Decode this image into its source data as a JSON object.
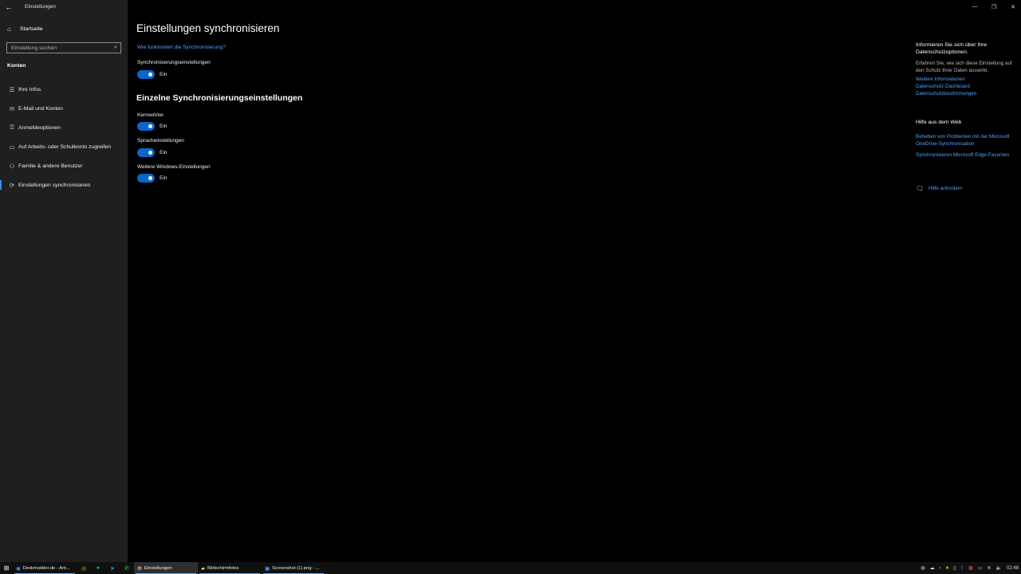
{
  "window": {
    "title": "Einstellungen",
    "minimize_glyph": "—",
    "restore_glyph": "❐",
    "close_glyph": "✕"
  },
  "sidebar": {
    "home_label": "Startseite",
    "search_placeholder": "Einstellung suchen",
    "section": "Konten",
    "items": [
      {
        "label": "Ihre Infos",
        "icon": "person-card-icon",
        "glyph": "☰"
      },
      {
        "label": "E-Mail und Konten",
        "icon": "mail-icon",
        "glyph": "✉"
      },
      {
        "label": "Anmeldeoptionen",
        "icon": "key-icon",
        "glyph": "⚿"
      },
      {
        "label": "Auf Arbeits- oder Schulkonto zugreifen",
        "icon": "briefcase-icon",
        "glyph": "▭"
      },
      {
        "label": "Familie & andere Benutzer",
        "icon": "user-add-icon",
        "glyph": "⚇"
      },
      {
        "label": "Einstellungen synchronisieren",
        "icon": "sync-icon",
        "glyph": "⟳"
      }
    ]
  },
  "main": {
    "title": "Einstellungen synchronisieren",
    "how_link": "Wie funktioniert die Synchronisierung?",
    "sync_label": "Synchronisierungseinstellungen",
    "sync_state": "Ein",
    "individual_heading": "Einzelne Synchronisierungseinstellungen",
    "toggles": [
      {
        "label": "Kennwörter",
        "state": "Ein"
      },
      {
        "label": "Spracheinstellungen",
        "state": "Ein"
      },
      {
        "label": "Weitere Windows-Einstellungen",
        "state": "Ein"
      }
    ]
  },
  "right_panel": {
    "privacy_heading": "Informieren Sie sich über Ihre Datenschutzoptionen.",
    "privacy_text": "Erfahren Sie, wie sich diese Einstellung auf den Schutz Ihrer Daten auswirkt.",
    "privacy_links": [
      "Weitere Informationen",
      "Datenschutz-Dashboard",
      "Datenschutzbestimmungen"
    ],
    "web_heading": "Hilfe aus dem Web",
    "web_links": [
      "Beheben von Problemen mit der Microsoft OneDrive-Synchronisation",
      "Synchronisieren Microsoft Edge-Favoriten"
    ],
    "help_link": "Hilfe anfordern"
  },
  "taskbar": {
    "apps": [
      {
        "label": "Deskmodder.de - Ant...",
        "icon": "browser-icon"
      },
      {
        "label": "Einstellungen",
        "icon": "settings-icon"
      },
      {
        "label": "Bildschirmfotos",
        "icon": "folder-icon"
      },
      {
        "label": "Screenshot (1).png - ...",
        "icon": "image-icon"
      }
    ],
    "clock": "02:48"
  },
  "colors": {
    "accent": "#0a66c8",
    "link": "#4aa3ff",
    "sidebar_bg": "#1f1f1f",
    "main_bg": "#000000"
  }
}
